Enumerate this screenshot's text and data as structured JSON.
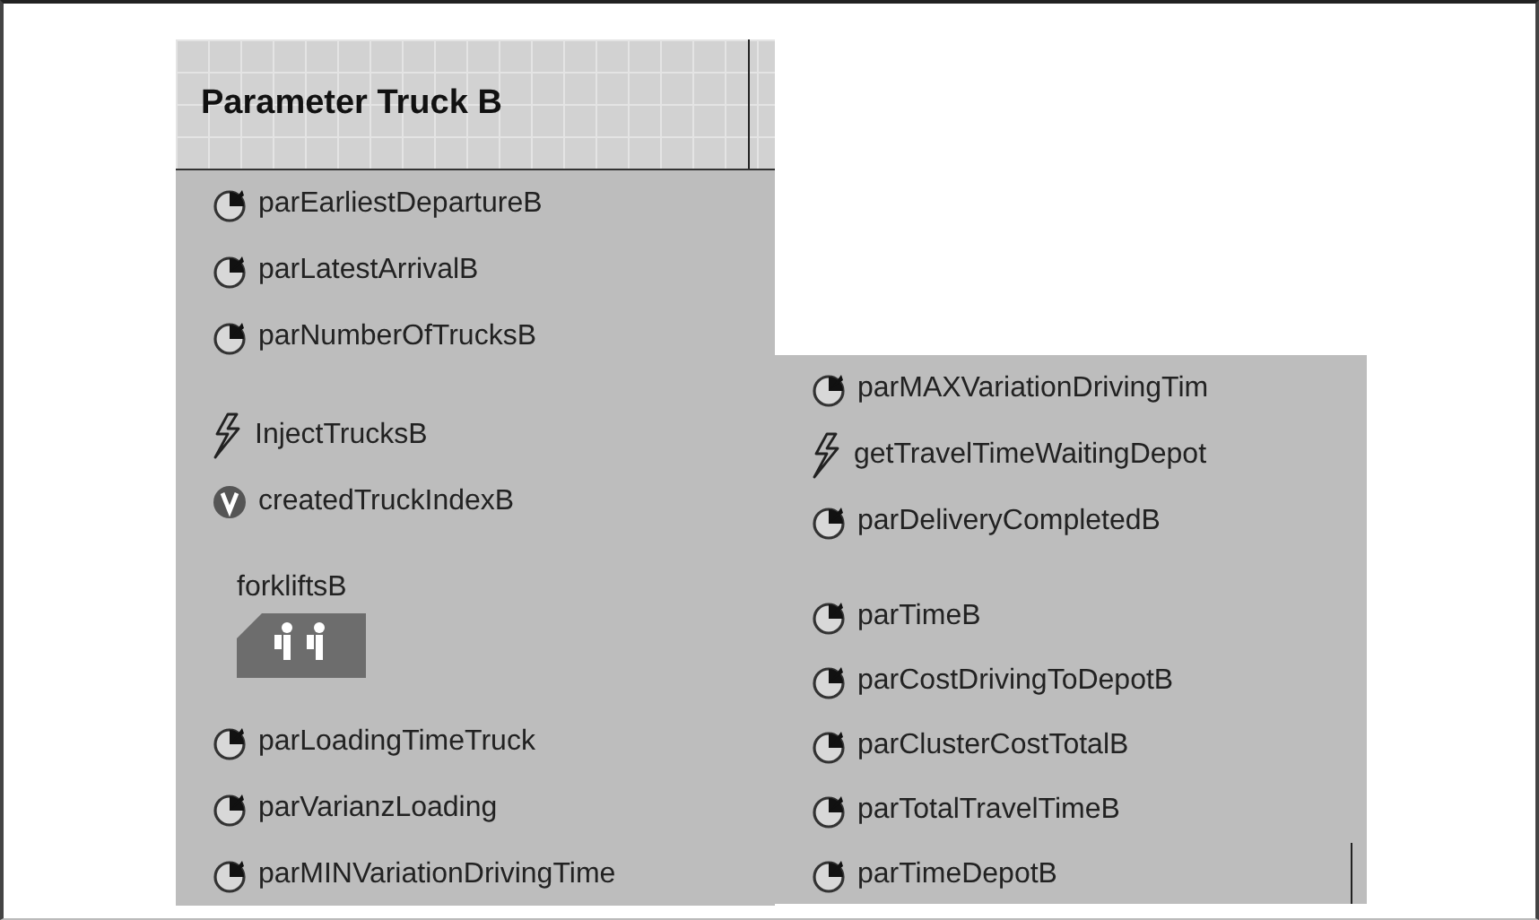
{
  "header": {
    "title": "Parameter Truck B"
  },
  "left_panel": {
    "items": [
      {
        "kind": "parameter",
        "label": "parEarliestDepartureB"
      },
      {
        "kind": "parameter",
        "label": "parLatestArrivalB"
      },
      {
        "kind": "parameter",
        "label": "parNumberOfTrucksB"
      },
      {
        "kind": "event",
        "label": "InjectTrucksB"
      },
      {
        "kind": "variable",
        "label": "createdTruckIndexB"
      },
      {
        "kind": "pool",
        "label": "forkliftsB"
      },
      {
        "kind": "parameter",
        "label": "parLoadingTimeTruck"
      },
      {
        "kind": "parameter",
        "label": "parVarianzLoading"
      },
      {
        "kind": "parameter",
        "label": "parMINVariationDrivingTime"
      }
    ]
  },
  "right_panel": {
    "items": [
      {
        "kind": "parameter",
        "label": "parMAXVariationDrivingTim"
      },
      {
        "kind": "event",
        "label": "getTravelTimeWaitingDepot"
      },
      {
        "kind": "parameter",
        "label": "parDeliveryCompletedB"
      },
      {
        "kind": "parameter",
        "label": "parTimeB"
      },
      {
        "kind": "parameter",
        "label": "parCostDrivingToDepotB"
      },
      {
        "kind": "parameter",
        "label": "parClusterCostTotalB"
      },
      {
        "kind": "parameter",
        "label": "parTotalTravelTimeB"
      },
      {
        "kind": "parameter",
        "label": "parTimeDepotB"
      }
    ]
  }
}
